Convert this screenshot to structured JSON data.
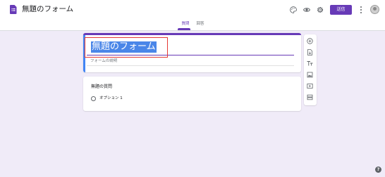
{
  "header": {
    "doc_title": "無題のフォーム",
    "send_label": "送信",
    "icons": [
      "form-icon",
      "palette-icon",
      "preview-eye-icon",
      "settings-gear-icon",
      "more-vert-icon",
      "avatar"
    ]
  },
  "tabs": [
    {
      "label": "質問",
      "active": true
    },
    {
      "label": "回答",
      "active": false
    }
  ],
  "form": {
    "title": "無題のフォーム",
    "description_placeholder": "フォームの説明"
  },
  "question": {
    "title": "無題の質問",
    "options": [
      "オプション 1"
    ]
  },
  "side_toolbar": {
    "icons": [
      "add-question-icon",
      "import-questions-icon",
      "add-title-icon",
      "add-image-icon",
      "add-video-icon",
      "add-section-icon"
    ]
  },
  "help": {
    "label": "?"
  },
  "colors": {
    "accent": "#673ab7",
    "background": "#f0ebf8",
    "title_card_left": "#4285f4",
    "selection": "#4a86e8",
    "highlight_box": "#e53935"
  }
}
